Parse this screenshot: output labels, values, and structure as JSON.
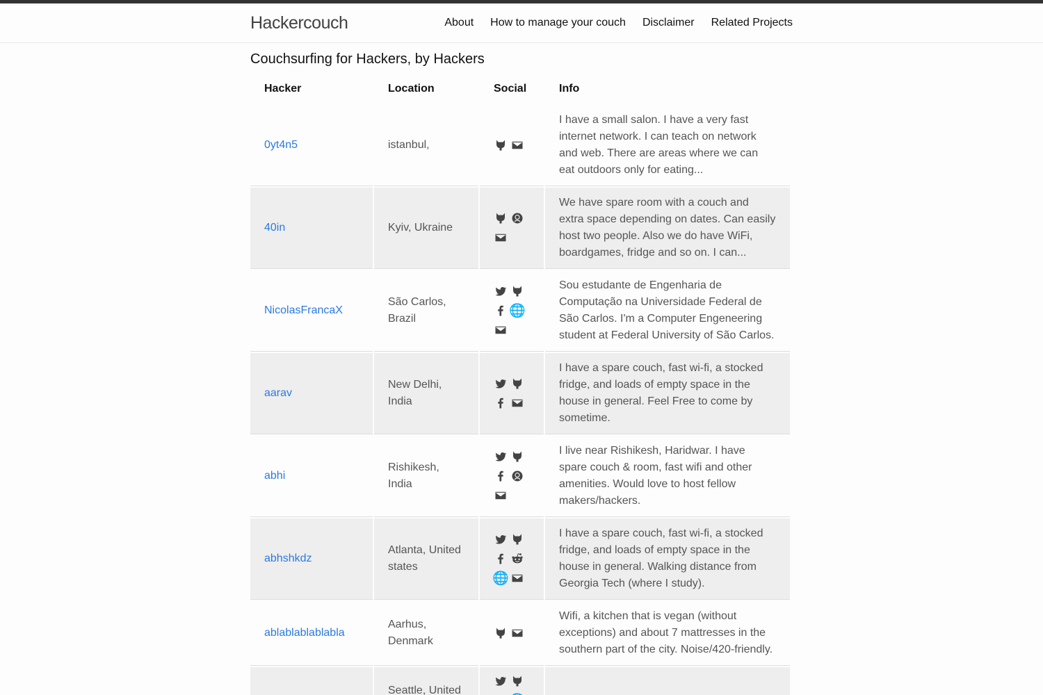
{
  "header": {
    "site_title": "Hackercouch",
    "nav": [
      "About",
      "How to manage your couch",
      "Disclaimer",
      "Related Projects"
    ]
  },
  "page_title": "Couchsurfing for Hackers, by Hackers",
  "table": {
    "columns": [
      "Hacker",
      "Location",
      "Social",
      "Info"
    ],
    "rows": [
      {
        "hacker": "0yt4n5",
        "location": "istanbul,",
        "social": [
          "github",
          "email"
        ],
        "info": "I have a small salon. I have a very fast internet network. I can teach on network and web. There are areas where we can eat outdoors only for eating..."
      },
      {
        "hacker": "40in",
        "location": "Kyiv, Ukraine",
        "social": [
          "github",
          "keybase",
          "email"
        ],
        "info": "We have spare room with a couch and extra space depending on dates. Can easily host two people. Also we do have WiFi, boardgames, fridge and so on. I can..."
      },
      {
        "hacker": "NicolasFrancaX",
        "location": "São Carlos, Brazil",
        "social": [
          "twitter",
          "github",
          "facebook",
          "globe",
          "email"
        ],
        "info": "Sou estudante de Engenharia de Computação na Universidade Federal de São Carlos. I'm a Computer Engeneering student at Federal University of São Carlos."
      },
      {
        "hacker": "aarav",
        "location": "New Delhi, India",
        "social": [
          "twitter",
          "github",
          "facebook",
          "email"
        ],
        "info": "I have a spare couch, fast wi-fi, a stocked fridge, and loads of empty space in the house in general. Feel Free to come by sometime."
      },
      {
        "hacker": "abhi",
        "location": "Rishikesh, India",
        "social": [
          "twitter",
          "github",
          "facebook",
          "keybase",
          "email"
        ],
        "info": "I live near Rishikesh, Haridwar. I have spare couch & room, fast wifi and other amenities. Would love to host fellow makers/hackers."
      },
      {
        "hacker": "abhshkdz",
        "location": "Atlanta, United states",
        "social": [
          "twitter",
          "github",
          "facebook",
          "reddit",
          "globe",
          "email"
        ],
        "info": "I have a spare couch, fast wi-fi, a stocked fridge, and loads of empty space in the house in general. Walking distance from Georgia Tech (where I study)."
      },
      {
        "hacker": "ablablablablabla",
        "location": "Aarhus, Denmark",
        "social": [
          "github",
          "email"
        ],
        "info": "Wifi, a kitchen that is vegan (without exceptions) and about 7 mattresses in the southern part of the city. Noise/420-friendly."
      },
      {
        "hacker": "",
        "location": "Seattle, United",
        "social": [
          "twitter",
          "github",
          "facebook",
          "globe"
        ],
        "info": ""
      }
    ]
  }
}
